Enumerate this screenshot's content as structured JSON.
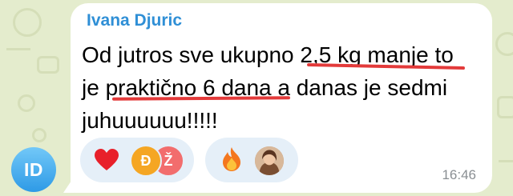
{
  "chat": {
    "avatar_initials": "ID",
    "sender_name": "Ivana Djuric",
    "message_lines": [
      "Od jutros sve ukupno 2,5 kg manje to",
      "je praktično 6 dana a danas je sedmi",
      "juhuuuuuu!!!!!"
    ],
    "timestamp": "16:46"
  },
  "reactions": [
    {
      "emoji_name": "red-heart",
      "reactors": [
        {
          "initial": "Đ",
          "color": "#f5a623"
        },
        {
          "initial": "Ž",
          "color": "#f26d6d"
        }
      ]
    },
    {
      "emoji_name": "fire",
      "reactors": [
        {
          "type": "photo"
        }
      ]
    }
  ],
  "colors": {
    "sender_name": "#2f8fd6",
    "annotation_underline": "#e33a3a",
    "reaction_chip": "#e5eff8",
    "avatar_gradient_top": "#72c8f8",
    "avatar_gradient_bottom": "#2e9ae6"
  }
}
